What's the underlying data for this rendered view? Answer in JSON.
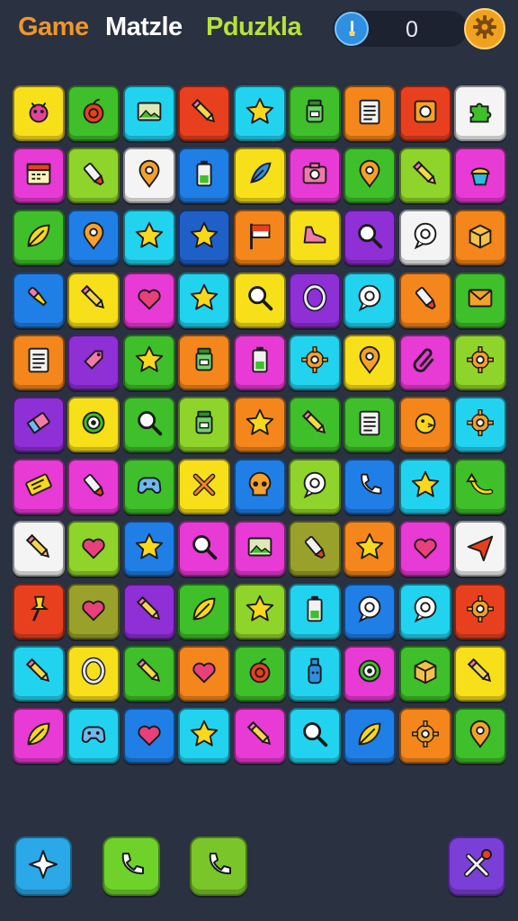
{
  "header": {
    "title_parts": [
      "Game",
      "Matzle",
      "Pduzkla"
    ],
    "score": "0"
  },
  "colors": {
    "yellow": "#f7e01a",
    "green": "#3fbf2a",
    "blue": "#1f7fe6",
    "red": "#e8401f",
    "cyan": "#22d3f0",
    "orange": "#f5861c",
    "purple": "#8f2fd6",
    "magenta": "#e83ad4",
    "white": "#f4f4f4",
    "lime": "#8fd42a",
    "olive": "#9aa12a",
    "darkblue": "#1f5fc8"
  },
  "board": {
    "rows": [
      [
        {
          "color": "yellow",
          "icon": "bug-icon"
        },
        {
          "color": "green",
          "icon": "apple-icon"
        },
        {
          "color": "cyan",
          "icon": "picture-icon"
        },
        {
          "color": "red",
          "icon": "pencil-icon"
        },
        {
          "color": "cyan",
          "icon": "star-icon"
        },
        {
          "color": "green",
          "icon": "jar-icon"
        },
        {
          "color": "orange",
          "icon": "notepad-icon"
        },
        {
          "color": "red",
          "icon": "photo-icon"
        },
        {
          "color": "white",
          "icon": "puzzle-icon"
        }
      ],
      [
        {
          "color": "magenta",
          "icon": "calendar-icon"
        },
        {
          "color": "lime",
          "icon": "marker-icon"
        },
        {
          "color": "white",
          "icon": "map-pin-icon"
        },
        {
          "color": "blue",
          "icon": "battery-icon"
        },
        {
          "color": "yellow",
          "icon": "feather-icon"
        },
        {
          "color": "magenta",
          "icon": "camera-icon"
        },
        {
          "color": "green",
          "icon": "map-pin-icon"
        },
        {
          "color": "lime",
          "icon": "pencil-icon"
        },
        {
          "color": "magenta",
          "icon": "cupcake-icon"
        }
      ],
      [
        {
          "color": "green",
          "icon": "leaf-icon"
        },
        {
          "color": "blue",
          "icon": "map-pin-icon"
        },
        {
          "color": "cyan",
          "icon": "star-icon"
        },
        {
          "color": "darkblue",
          "icon": "star-icon"
        },
        {
          "color": "orange",
          "icon": "flag-icon"
        },
        {
          "color": "yellow",
          "icon": "shoe-icon"
        },
        {
          "color": "purple",
          "icon": "search-icon"
        },
        {
          "color": "white",
          "icon": "chat-icon"
        },
        {
          "color": "orange",
          "icon": "cube-icon"
        }
      ],
      [
        {
          "color": "blue",
          "icon": "dropper-icon"
        },
        {
          "color": "yellow",
          "icon": "pencil-icon"
        },
        {
          "color": "magenta",
          "icon": "heart-icon"
        },
        {
          "color": "cyan",
          "icon": "star-icon"
        },
        {
          "color": "yellow",
          "icon": "search-icon"
        },
        {
          "color": "purple",
          "icon": "ring-icon"
        },
        {
          "color": "cyan",
          "icon": "chat-icon"
        },
        {
          "color": "orange",
          "icon": "marker-icon"
        },
        {
          "color": "green",
          "icon": "envelope-icon"
        }
      ],
      [
        {
          "color": "orange",
          "icon": "notepad-icon"
        },
        {
          "color": "purple",
          "icon": "tag-icon"
        },
        {
          "color": "green",
          "icon": "star-icon"
        },
        {
          "color": "orange",
          "icon": "jar-icon"
        },
        {
          "color": "magenta",
          "icon": "battery-icon"
        },
        {
          "color": "cyan",
          "icon": "gear-icon"
        },
        {
          "color": "yellow",
          "icon": "map-pin-icon"
        },
        {
          "color": "magenta",
          "icon": "paperclip-icon"
        },
        {
          "color": "lime",
          "icon": "gear-icon"
        }
      ],
      [
        {
          "color": "purple",
          "icon": "eraser-icon"
        },
        {
          "color": "yellow",
          "icon": "target-icon"
        },
        {
          "color": "green",
          "icon": "search-icon"
        },
        {
          "color": "lime",
          "icon": "jar-icon"
        },
        {
          "color": "orange",
          "icon": "star-icon"
        },
        {
          "color": "green",
          "icon": "pencil-icon"
        },
        {
          "color": "green",
          "icon": "notepad-icon"
        },
        {
          "color": "orange",
          "icon": "chick-icon"
        },
        {
          "color": "cyan",
          "icon": "gear-icon"
        }
      ],
      [
        {
          "color": "magenta",
          "icon": "ticket-icon"
        },
        {
          "color": "magenta",
          "icon": "marker-icon"
        },
        {
          "color": "green",
          "icon": "gamepad-icon"
        },
        {
          "color": "yellow",
          "icon": "cross-icon"
        },
        {
          "color": "blue",
          "icon": "skull-icon"
        },
        {
          "color": "lime",
          "icon": "chat-icon"
        },
        {
          "color": "blue",
          "icon": "phone-icon"
        },
        {
          "color": "cyan",
          "icon": "star-icon"
        },
        {
          "color": "green",
          "icon": "arrow-icon"
        }
      ],
      [
        {
          "color": "white",
          "icon": "pencil-icon"
        },
        {
          "color": "lime",
          "icon": "heart-icon"
        },
        {
          "color": "blue",
          "icon": "star-icon"
        },
        {
          "color": "magenta",
          "icon": "search-icon"
        },
        {
          "color": "magenta",
          "icon": "picture-icon"
        },
        {
          "color": "olive",
          "icon": "marker-icon"
        },
        {
          "color": "orange",
          "icon": "star-icon"
        },
        {
          "color": "magenta",
          "icon": "heart-icon"
        },
        {
          "color": "white",
          "icon": "plane-icon"
        }
      ],
      [
        {
          "color": "red",
          "icon": "pin-icon"
        },
        {
          "color": "olive",
          "icon": "heart-icon"
        },
        {
          "color": "purple",
          "icon": "pencil-icon"
        },
        {
          "color": "green",
          "icon": "leaf-icon"
        },
        {
          "color": "lime",
          "icon": "star-icon"
        },
        {
          "color": "cyan",
          "icon": "battery-icon"
        },
        {
          "color": "blue",
          "icon": "chat-icon"
        },
        {
          "color": "cyan",
          "icon": "chat-icon"
        },
        {
          "color": "red",
          "icon": "gear-icon"
        }
      ],
      [
        {
          "color": "cyan",
          "icon": "pencil-icon"
        },
        {
          "color": "yellow",
          "icon": "ring-icon"
        },
        {
          "color": "green",
          "icon": "pencil-icon"
        },
        {
          "color": "orange",
          "icon": "heart-icon"
        },
        {
          "color": "green",
          "icon": "apple-icon"
        },
        {
          "color": "cyan",
          "icon": "bottle-icon"
        },
        {
          "color": "magenta",
          "icon": "target-icon"
        },
        {
          "color": "green",
          "icon": "cube-icon"
        },
        {
          "color": "yellow",
          "icon": "pencil-icon"
        }
      ],
      [
        {
          "color": "magenta",
          "icon": "leaf-icon"
        },
        {
          "color": "cyan",
          "icon": "gamepad-icon"
        },
        {
          "color": "blue",
          "icon": "heart-icon"
        },
        {
          "color": "cyan",
          "icon": "star-icon"
        },
        {
          "color": "magenta",
          "icon": "pencil-icon"
        },
        {
          "color": "cyan",
          "icon": "search-icon"
        },
        {
          "color": "blue",
          "icon": "leaf-icon"
        },
        {
          "color": "orange",
          "icon": "gear-icon"
        },
        {
          "color": "green",
          "icon": "map-pin-icon"
        }
      ]
    ]
  },
  "footer": {
    "buttons": [
      {
        "name": "shuffle-button",
        "icon": "sparkle-icon",
        "color": "#2aa8e8"
      },
      {
        "name": "phone-button",
        "icon": "phone-icon",
        "color": "#6fd22a"
      },
      {
        "name": "call-back-button",
        "icon": "phone-icon",
        "color": "#7ac62a"
      },
      {
        "name": "tools-button",
        "icon": "tools-icon",
        "color": "#7a3fd6"
      }
    ]
  }
}
